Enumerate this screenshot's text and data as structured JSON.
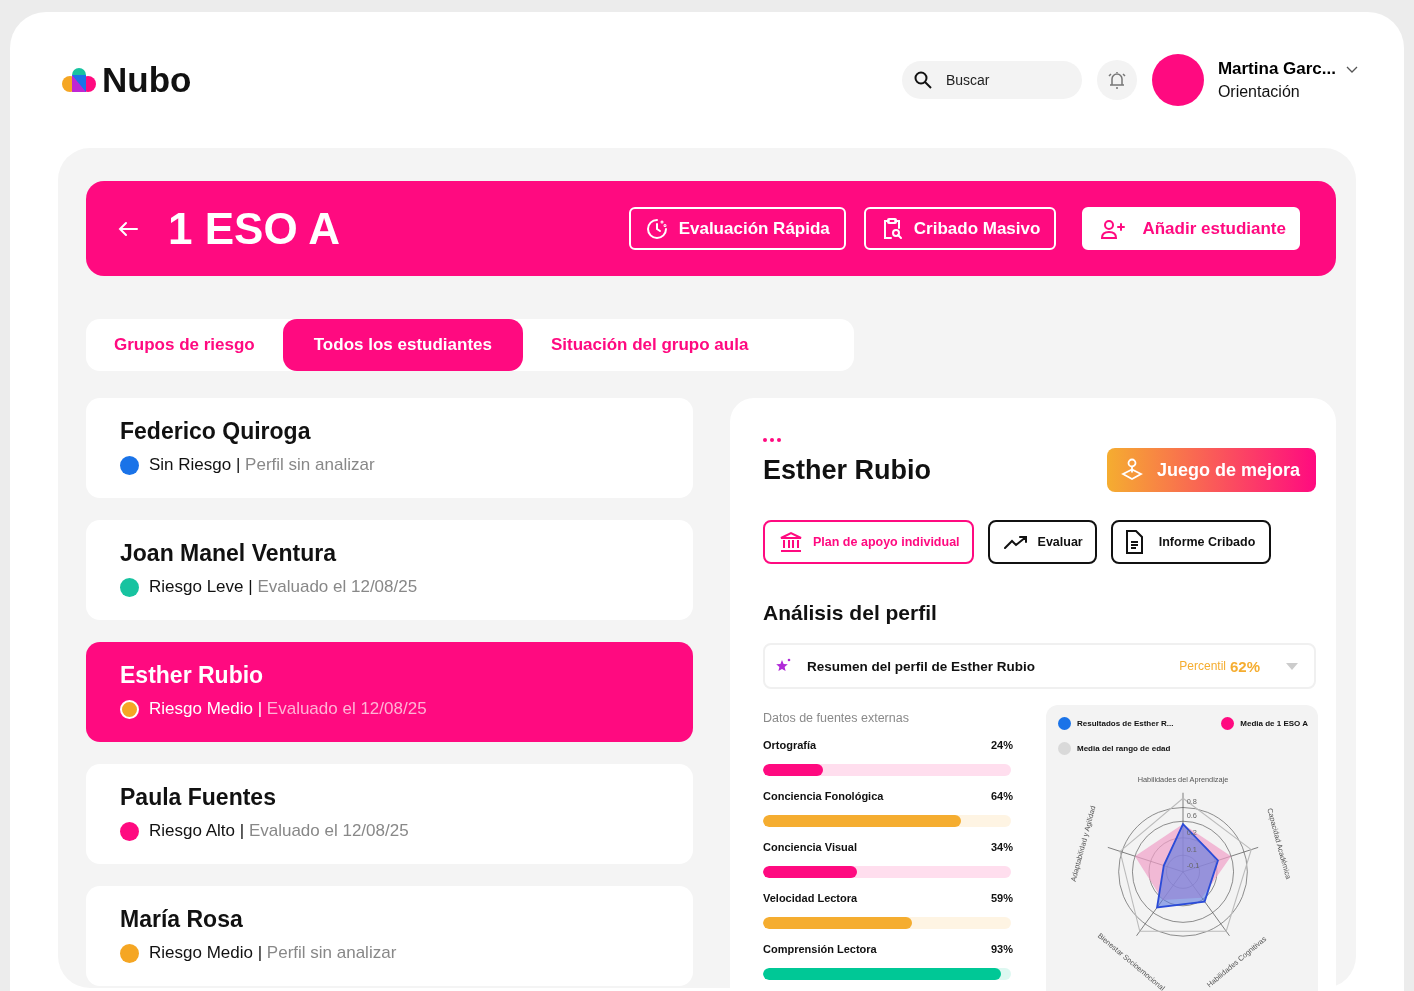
{
  "header": {
    "logo": "Nubo",
    "search": {
      "placeholder": "Buscar"
    },
    "user": {
      "name": "Martina Garc...",
      "role": "Orientación"
    }
  },
  "banner": {
    "title": "1 ESO A",
    "actions": [
      {
        "label": "Evaluación Rápida",
        "kind": "outline"
      },
      {
        "label": "Cribado Masivo",
        "kind": "outline"
      },
      {
        "label": "Añadir estudiante",
        "kind": "solid"
      }
    ]
  },
  "tabs": [
    {
      "label": "Grupos de riesgo",
      "selected": false
    },
    {
      "label": "Todos los estudiantes",
      "selected": true
    },
    {
      "label": "Situación del grupo aula",
      "selected": false
    }
  ],
  "separator": "|",
  "students": [
    {
      "name": "Federico Quiroga",
      "risk": "Sin Riesgo",
      "status": "Perfil sin analizar",
      "color": "#1a73e8",
      "selected": false
    },
    {
      "name": "Joan Manel Ventura",
      "risk": "Riesgo Leve",
      "status": "Evaluado el 12/08/25",
      "color": "#17c3a0",
      "selected": false
    },
    {
      "name": "Esther Rubio",
      "risk": "Riesgo Medio",
      "status": "Evaluado el 12/08/25",
      "color": "#f5a623",
      "selected": true
    },
    {
      "name": "Paula Fuentes",
      "risk": "Riesgo Alto",
      "status": "Evaluado el 12/08/25",
      "color": "#ff0a80",
      "selected": false
    },
    {
      "name": "María Rosa",
      "risk": "Riesgo Medio",
      "status": "Perfil sin analizar",
      "color": "#f5a623",
      "selected": false
    }
  ],
  "detail": {
    "name": "Esther Rubio",
    "game_button": "Juego de mejora",
    "actions": [
      {
        "label": "Plan de apoyo individual",
        "kind": "primary"
      },
      {
        "label": "Evaluar",
        "kind": "outline"
      },
      {
        "label": "Informe Cribado",
        "kind": "outline"
      }
    ],
    "section_title": "Análisis del perfil",
    "summary": {
      "text": "Resumen del perfil de Esther Rubio",
      "percentile_label": "Percentil",
      "percentile": "62%",
      "expanded": false
    },
    "external": {
      "title": "Datos de fuentes externas",
      "metrics": [
        {
          "name": "Ortografía",
          "value": "24%",
          "level": 0.24,
          "color": "#ff0a80"
        },
        {
          "name": "Conciencia Fonológica",
          "value": "64%",
          "level": 0.8,
          "color": "#f5ad30"
        },
        {
          "name": "Conciencia Visual",
          "value": "34%",
          "level": 0.38,
          "color": "#ff0a80"
        },
        {
          "name": "Velocidad Lectora",
          "value": "59%",
          "level": 0.6,
          "color": "#f5ad30"
        },
        {
          "name": "Comprensión Lectora",
          "value": "93%",
          "level": 0.96,
          "color": "#00c896"
        }
      ]
    },
    "radar": {
      "legend": [
        {
          "label": "Resultados de Esther R...",
          "color": "#1a73e8"
        },
        {
          "label": "Media de 1 ESO A",
          "color": "#ff0a80"
        },
        {
          "label": "Media del rango de edad",
          "color": "#d9d9d9"
        }
      ],
      "axes": [
        "Habilidades del Aprendizaje",
        "Capacidad Académica",
        "Habilidades Cognitivas",
        "Bienestar Socioemocional",
        "Adaptabilidad y Agilidad"
      ],
      "ticks": [
        "0.8",
        "0.6",
        "0.2",
        "0.1",
        "-0.1"
      ]
    }
  }
}
